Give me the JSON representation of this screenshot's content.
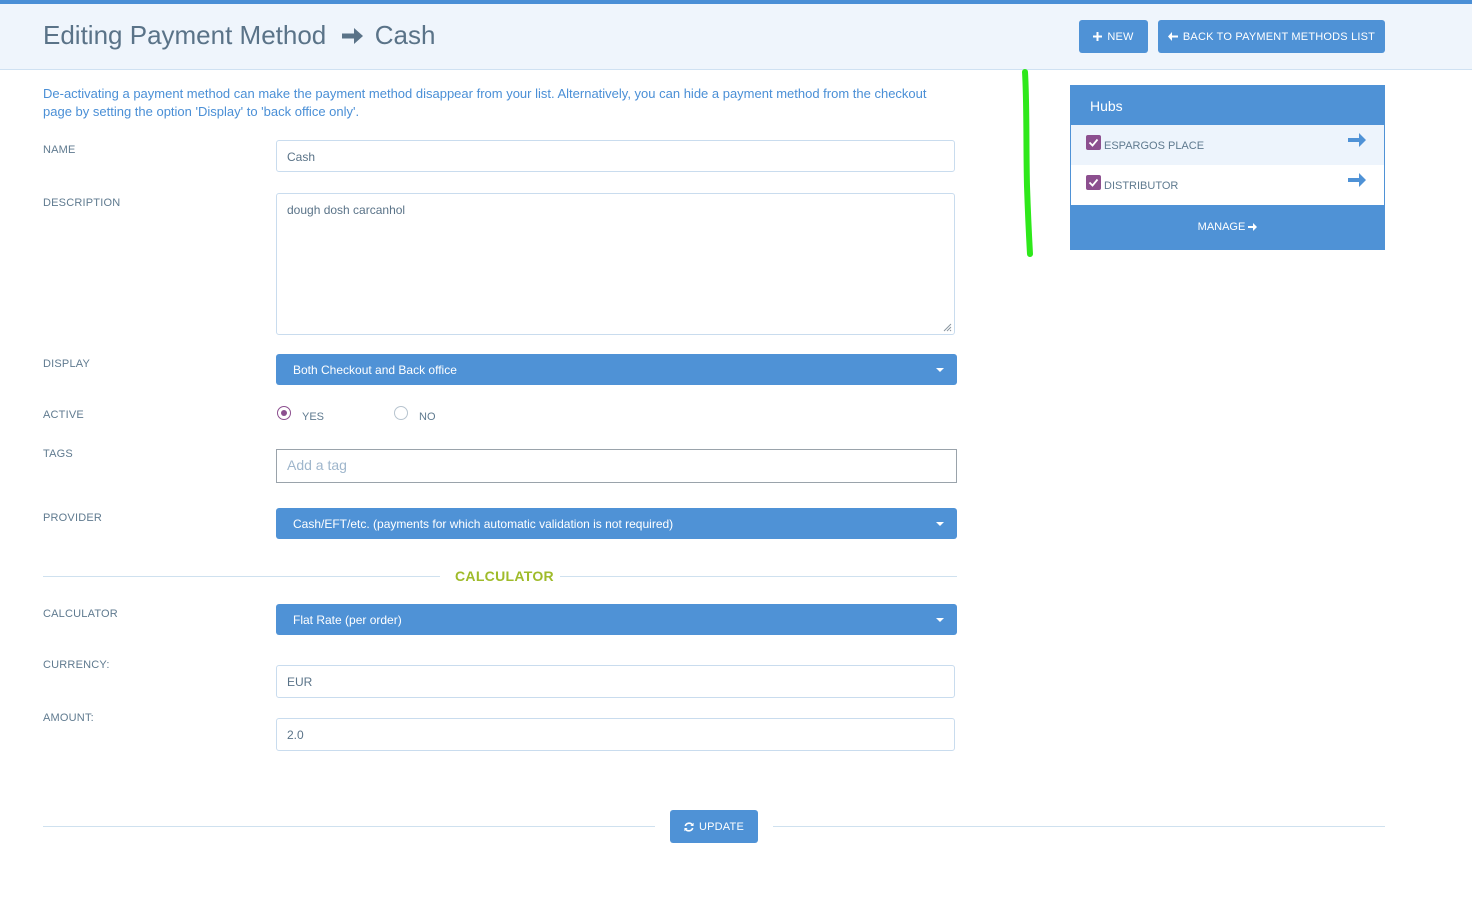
{
  "header": {
    "title": "Editing Payment Method",
    "subject": "Cash",
    "new_label": "NEW",
    "back_label": "BACK TO PAYMENT METHODS LIST"
  },
  "notice": "De-activating a payment method can make the payment method disappear from your list. Alternatively, you can hide a payment method from the checkout page by setting the option 'Display' to 'back office only'.",
  "form": {
    "name_label": "NAME",
    "name_value": "Cash",
    "description_label": "DESCRIPTION",
    "description_value": "dough dosh carcanhol",
    "display_label": "DISPLAY",
    "display_value": "Both Checkout and Back office",
    "active_label": "ACTIVE",
    "active_yes": "YES",
    "active_no": "NO",
    "active_selected": "YES",
    "tags_label": "TAGS",
    "tags_placeholder": "Add a tag",
    "provider_label": "PROVIDER",
    "provider_value": "Cash/EFT/etc. (payments for which automatic validation is not required)"
  },
  "calculator": {
    "section_title": "CALCULATOR",
    "calculator_label": "CALCULATOR",
    "calculator_value": "Flat Rate (per order)",
    "currency_label": "CURRENCY:",
    "currency_value": "EUR",
    "amount_label": "AMOUNT:",
    "amount_value": "2.0"
  },
  "update_label": "UPDATE",
  "hubs": {
    "title": "Hubs",
    "items": [
      {
        "name": "ESPARGOS PLACE",
        "checked": true
      },
      {
        "name": "DISTRIBUTOR",
        "checked": true
      }
    ],
    "manage_label": "MANAGE"
  },
  "colors": {
    "accent": "#4f92d6",
    "checkbox": "#8c4f8f",
    "section_title": "#9fbb2a",
    "annotation": "#2ee81a"
  }
}
